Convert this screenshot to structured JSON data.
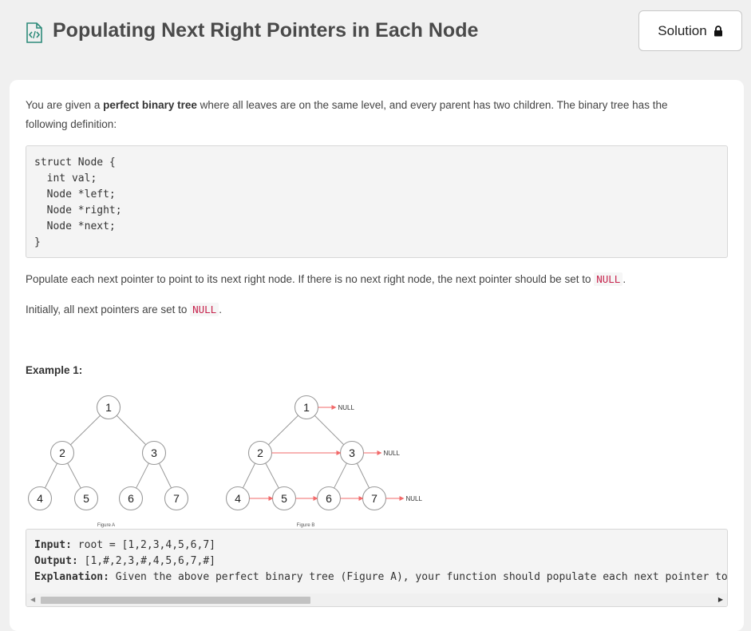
{
  "header": {
    "title": "Populating Next Right Pointers in Each Node",
    "solution_label": "Solution"
  },
  "description": {
    "p1_pre": "You are given a ",
    "p1_bold": "perfect binary tree",
    "p1_post": " where all leaves are on the same level, and every parent has two children. The binary tree has the following definition:",
    "code": "struct Node {\n  int val;\n  Node *left;\n  Node *right;\n  Node *next;\n}",
    "p2_text": "Populate each next pointer to point to its next right node. If there is no next right node, the next pointer should be set to ",
    "p2_code": "NULL",
    "p2_end": ".",
    "p3_text": "Initially, all next pointers are set to ",
    "p3_code": "NULL",
    "p3_end": "."
  },
  "example": {
    "title": "Example 1:",
    "figure_a": {
      "caption": "Figure A",
      "nodes": [
        "1",
        "2",
        "3",
        "4",
        "5",
        "6",
        "7"
      ]
    },
    "figure_b": {
      "caption": "Figure B",
      "nodes": [
        "1",
        "2",
        "3",
        "4",
        "5",
        "6",
        "7"
      ],
      "null_labels": [
        "NULL",
        "NULL",
        "NULL"
      ]
    },
    "input_label": "Input:",
    "input_value": " root = [1,2,3,4,5,6,7]",
    "output_label": "Output:",
    "output_value": " [1,#,2,3,#,4,5,6,7,#]",
    "explanation_label": "Explanation:",
    "explanation_value": " Given the above perfect binary tree (Figure A), your function should populate each next pointer to p"
  },
  "icons": {
    "title_icon": "code-file-icon",
    "lock_icon": "lock-icon",
    "scroll_left": "chevron-left-icon",
    "scroll_right": "chevron-right-icon"
  },
  "colors": {
    "page_bg": "#f0f0f0",
    "title": "#4a4a4a",
    "icon_accent": "#2e8b7a",
    "inline_code": "#c7254e",
    "pointer_red": "#f26a6a"
  }
}
